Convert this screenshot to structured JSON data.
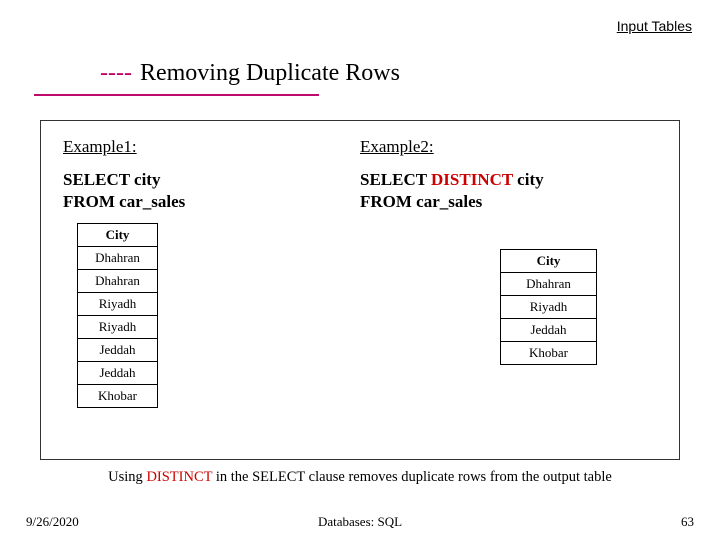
{
  "input_link": "Input Tables",
  "title": {
    "dashes": "----",
    "text": "Removing Duplicate Rows"
  },
  "example1": {
    "label": "Example1:",
    "query_line1": "SELECT city",
    "query_line2": "FROM car_sales",
    "col_header": "City",
    "rows": [
      "Dhahran",
      "Dhahran",
      "Riyadh",
      "Riyadh",
      "Jeddah",
      "Jeddah",
      "Khobar"
    ]
  },
  "example2": {
    "label": "Example2:",
    "query_prefix": "SELECT ",
    "query_distinct": "DISTINCT",
    "query_suffix": " city",
    "query_line2": "FROM car_sales",
    "col_header": "City",
    "rows": [
      "Dhahran",
      "Riyadh",
      "Jeddah",
      "Khobar"
    ]
  },
  "explain": {
    "pre": "Using ",
    "dist": "DISTINCT",
    "post": " in the SELECT clause removes duplicate rows from the output table"
  },
  "footer": {
    "date": "9/26/2020",
    "center": "Databases: SQL",
    "page": "63"
  }
}
